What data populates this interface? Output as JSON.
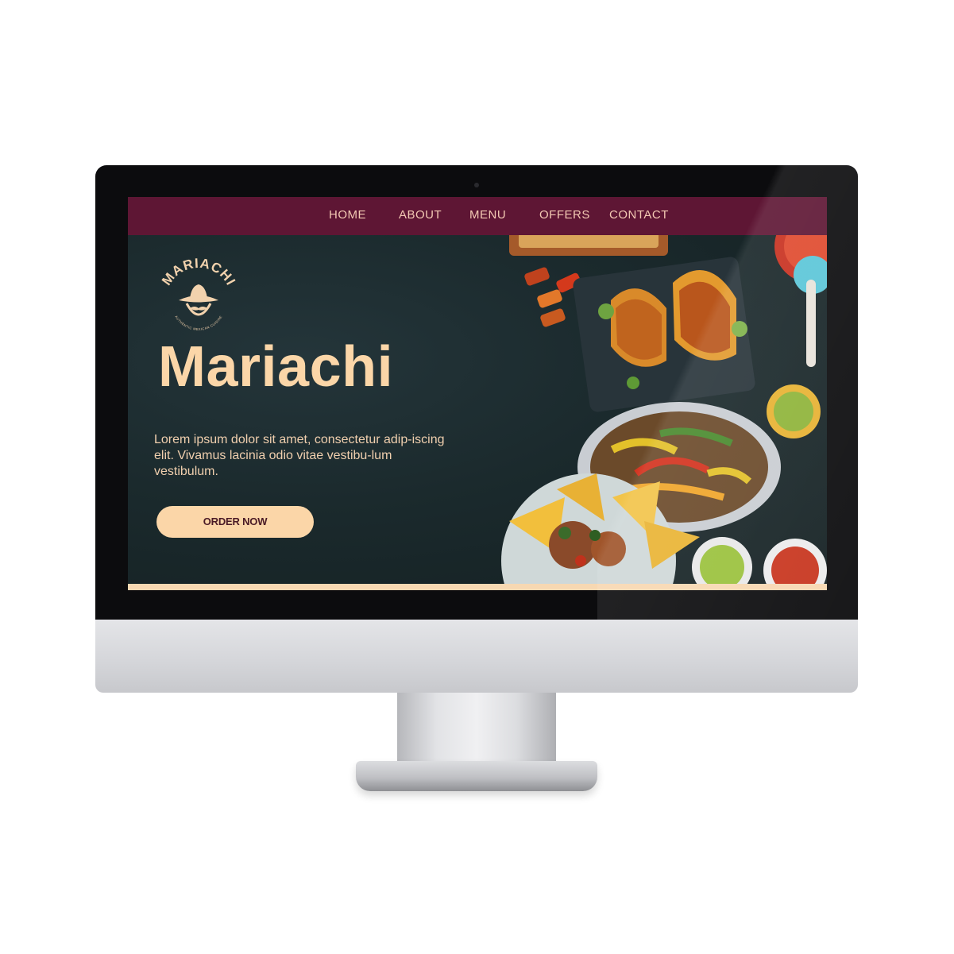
{
  "nav": {
    "items": [
      "HOME",
      "ABOUT",
      "MENU",
      "OFFERS",
      "CONTACT"
    ]
  },
  "hero": {
    "logo_text": "MARIACHI",
    "logo_subtext": "AUTHENTIC MEXICAN CUISINE",
    "title": "Mariachi",
    "paragraph": "Lorem ipsum dolor sit amet, consectetur adip-iscing elit. Vivamus lacinia odio vitae vestibu-lum vestibulum.",
    "cta_label": "ORDER NOW",
    "image_icon": "mexican-food-photo"
  },
  "colors": {
    "nav_background": "#5e1634",
    "nav_text": "#f3c9b3",
    "hero_background": "#1b2a2d",
    "accent_peach": "#fbd6a8",
    "button_text": "#4a1a26"
  }
}
